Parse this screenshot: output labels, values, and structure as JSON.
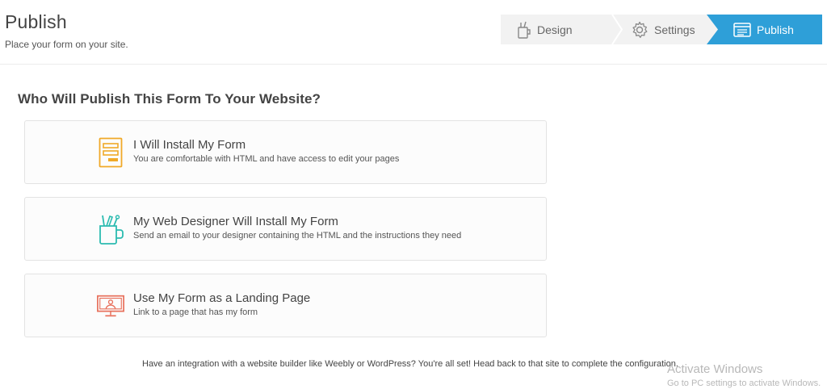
{
  "header": {
    "title": "Publish",
    "subtitle": "Place your form on your site."
  },
  "wizard": {
    "steps": [
      {
        "label": "Design",
        "icon": "pencil-cup-icon",
        "active": false
      },
      {
        "label": "Settings",
        "icon": "gear-icon",
        "active": false
      },
      {
        "label": "Publish",
        "icon": "browser-window-icon",
        "active": true
      }
    ],
    "active_color": "#2e9fd8"
  },
  "main": {
    "question": "Who Will Publish This Form To Your Website?",
    "options": [
      {
        "title": "I Will Install My Form",
        "description": "You are comfortable with HTML and have access to edit your pages",
        "icon": "form-document-icon",
        "icon_color": "#f0a928"
      },
      {
        "title": "My Web Designer Will Install My Form",
        "description": "Send an email to your designer containing the HTML and the instructions they need",
        "icon": "designer-tools-cup-icon",
        "icon_color": "#2bbbb0"
      },
      {
        "title": "Use My Form as a Landing Page",
        "description": "Link to a page that has my form",
        "icon": "presenter-screen-icon",
        "icon_color": "#e8705c"
      }
    ],
    "footnote": "Have an integration with a website builder like Weebly or WordPress? You're all set! Head back to that site to complete the configuration."
  },
  "watermark": {
    "title": "Activate Windows",
    "subtitle": "Go to PC settings to activate Windows."
  }
}
